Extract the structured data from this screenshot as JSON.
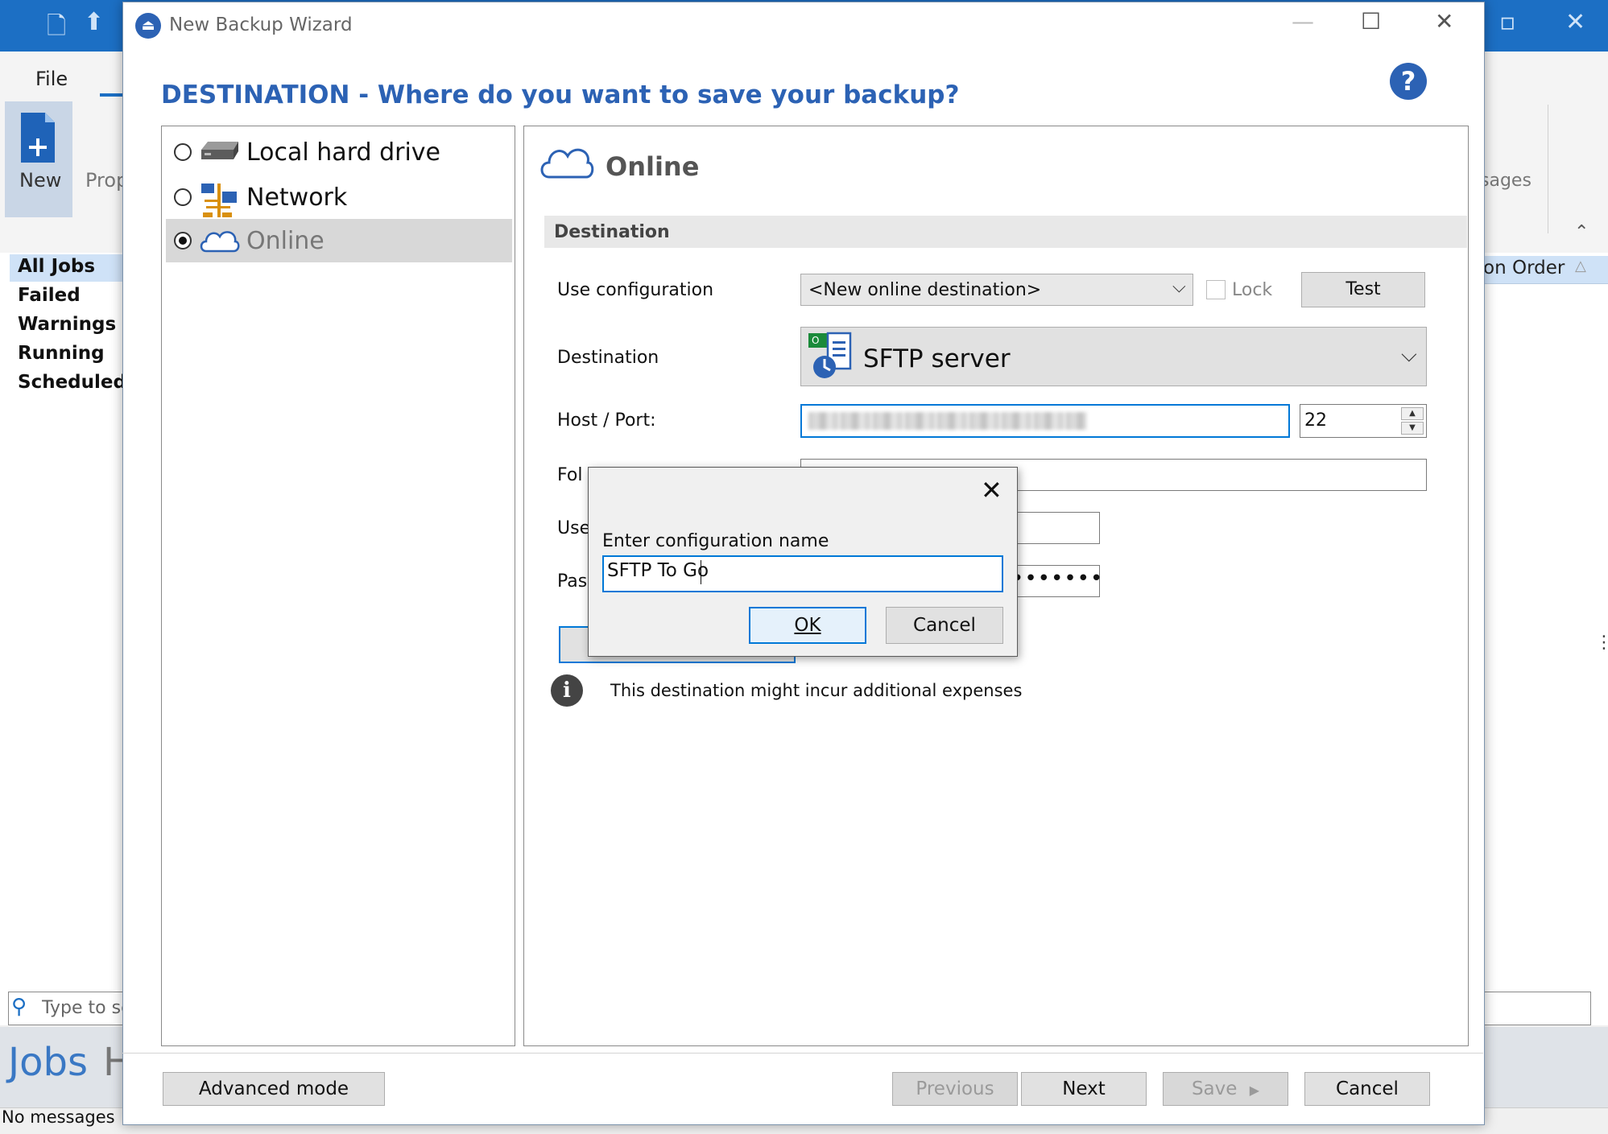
{
  "background_app": {
    "ribbon": {
      "file_tab": "File",
      "new_label": "New",
      "properties_label_partial": "Prop",
      "messages_label_partial": "sages"
    },
    "sidebar": {
      "items": [
        {
          "label": "All Jobs",
          "selected": true
        },
        {
          "label": "Failed"
        },
        {
          "label": "Warnings"
        },
        {
          "label": "Running"
        },
        {
          "label": "Scheduled"
        }
      ]
    },
    "grid": {
      "column_header_partial": "on Order"
    },
    "search": {
      "placeholder_partial": "Type to se"
    },
    "bottom_tabs": {
      "jobs": "Jobs",
      "h_partial": "H"
    },
    "status": {
      "text": "No messages"
    }
  },
  "wizard": {
    "title": "New Backup Wizard",
    "heading": "DESTINATION - Where do you want to save your backup?",
    "destinations": [
      {
        "label": "Local hard drive",
        "selected": false,
        "icon": "hard-drive-icon"
      },
      {
        "label": "Network",
        "selected": false,
        "icon": "network-icon"
      },
      {
        "label": "Online",
        "selected": true,
        "icon": "cloud-icon"
      }
    ],
    "panel_title": "Online",
    "section_title": "Destination",
    "fields": {
      "use_configuration": {
        "label": "Use configuration",
        "value": "<New online destination>"
      },
      "lock": {
        "label": "Lock",
        "checked": false
      },
      "test_button": "Test",
      "destination": {
        "label": "Destination",
        "value": "SFTP server"
      },
      "host_port": {
        "label": "Host / Port:",
        "port": "22"
      },
      "folder": {
        "label_partial": "Fol"
      },
      "user": {
        "label_partial": "Use"
      },
      "password": {
        "label_partial": "Pas",
        "masked": "•••••••"
      }
    },
    "info_text": "This destination might incur additional expenses",
    "footer": {
      "advanced_mode": "Advanced mode",
      "previous": "Previous",
      "next": "Next",
      "save": "Save",
      "cancel": "Cancel"
    }
  },
  "dialog": {
    "prompt": "Enter configuration name",
    "value": "SFTP To Go",
    "ok": "OK",
    "cancel": "Cancel"
  },
  "colors": {
    "accent": "#2c62b4",
    "focus": "#0078d7",
    "titlebar": "#1c6fc4"
  }
}
